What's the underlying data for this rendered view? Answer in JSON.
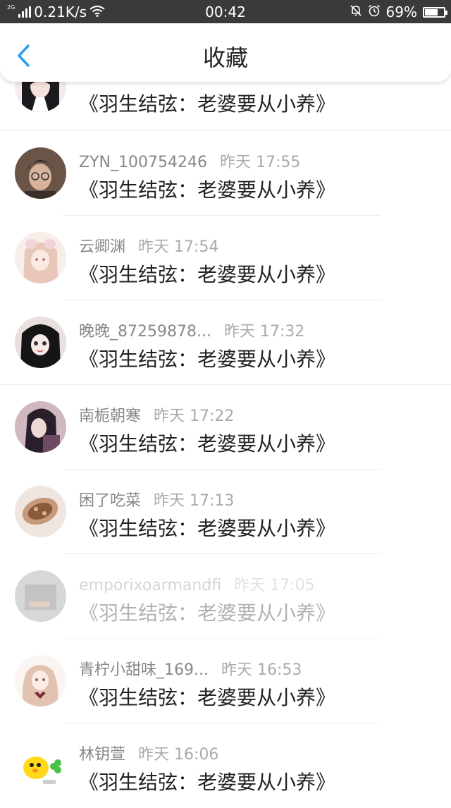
{
  "status_bar": {
    "network": "2G",
    "speed": "0.21K/s",
    "time": "00:42",
    "battery": "69%",
    "battery_level": 0.69
  },
  "header": {
    "title": "收藏"
  },
  "book_title": "《羽生结弦：老婆要从小养》",
  "items": [
    {
      "name": "",
      "time": ""
    },
    {
      "name": "ZYN_100754246",
      "time": "昨天 17:55"
    },
    {
      "name": "云卿渊",
      "time": "昨天 17:54"
    },
    {
      "name": "晚晚_87259878...",
      "time": "昨天 17:32"
    },
    {
      "name": "南栀朝寒",
      "time": "昨天 17:22"
    },
    {
      "name": "困了吃菜",
      "time": "昨天 17:13"
    },
    {
      "name": "emporixoarmandfi",
      "time": "昨天 17:05"
    },
    {
      "name": "青柠小甜味_169...",
      "time": "昨天 16:53"
    },
    {
      "name": "林钥萱",
      "time": "昨天 16:06"
    }
  ],
  "colors": {
    "accent": "#2a9df4",
    "status_bar": "#3a3a3a"
  },
  "icons": [
    "back-arrow-icon",
    "signal-icon",
    "wifi-icon",
    "mute-icon",
    "alarm-icon",
    "battery-icon"
  ]
}
